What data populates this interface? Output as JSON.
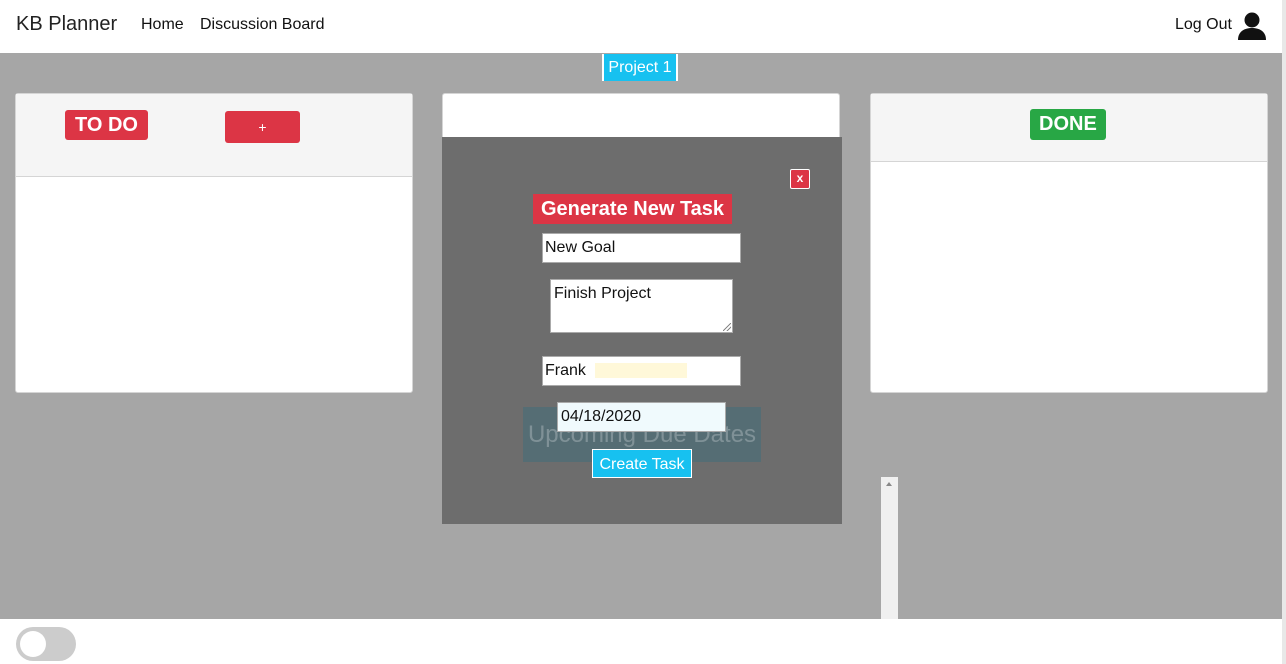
{
  "navbar": {
    "brand": "KB Planner",
    "links": [
      "Home",
      "Discussion Board"
    ],
    "logout": "Log Out"
  },
  "project_tab": "Project 1",
  "columns": {
    "todo": {
      "badge": "TO DO",
      "add_label": "+"
    },
    "done": {
      "badge": "DONE"
    }
  },
  "modal": {
    "close_label": "x",
    "title": "Generate New Task",
    "goal_value": "New Goal",
    "description_value": "Finish Project",
    "assignee_value": "Frank",
    "date_value": "04/18/2020",
    "submit_label": "Create Task"
  },
  "background_heading": "Upcoming Due Dates",
  "colors": {
    "accent_blue": "#17c1f0",
    "danger_red": "#dc3545",
    "success_green": "#28a745",
    "overlay_gray": "#a6a6a6"
  },
  "icons": [
    "user-icon",
    "scroll-up-arrow-icon"
  ]
}
